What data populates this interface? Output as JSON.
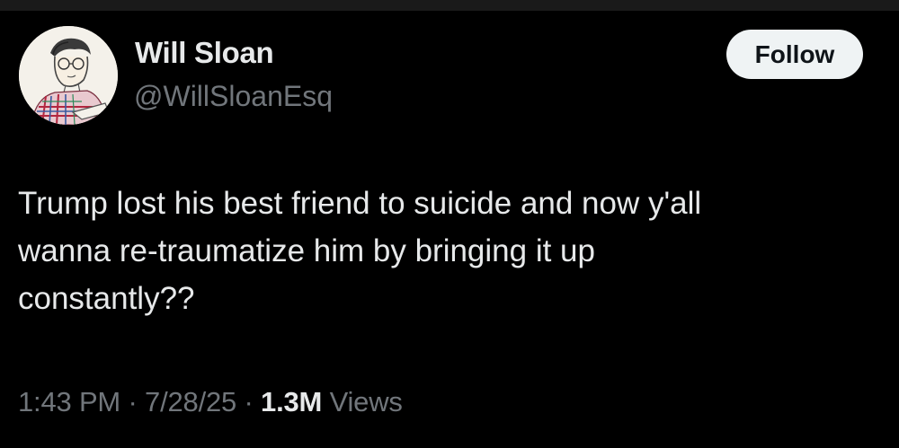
{
  "author": {
    "display_name": "Will Sloan",
    "handle": "@WillSloanEsq",
    "avatar_icon": "sketch-portrait-avatar"
  },
  "follow": {
    "label": "Follow"
  },
  "tweet": {
    "lines": [
      "Trump lost his best friend to suicide and now y'all",
      "wanna re-traumatize him by bringing it up",
      "constantly??"
    ]
  },
  "meta": {
    "time": "1:43 PM",
    "separator": "·",
    "date": "7/28/25",
    "views_count": "1.3M",
    "views_label": "Views"
  },
  "colors": {
    "background": "#000000",
    "primary_text": "#e7e9ea",
    "secondary_text": "#71767b",
    "button_bg": "#eff3f4"
  }
}
